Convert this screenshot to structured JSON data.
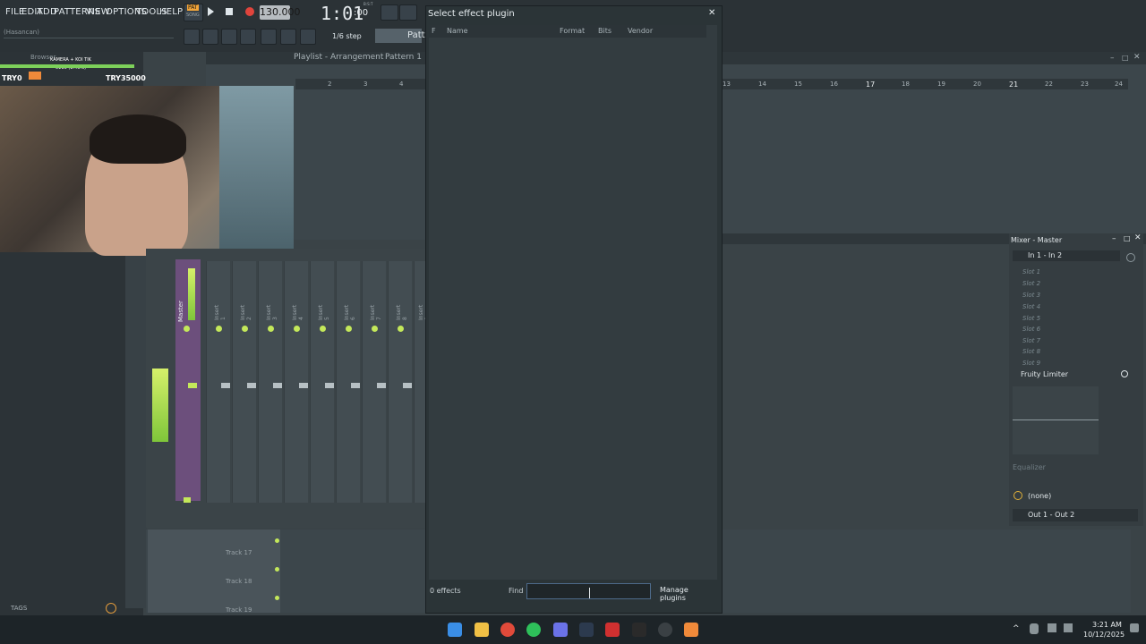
{
  "menu": [
    "FILE",
    "EDIT",
    "ADD",
    "PATTERNS",
    "VIEW",
    "OPTIONS",
    "TOOLS",
    "HELP"
  ],
  "transport": {
    "pat_label": "PAT",
    "song_label": "SONG",
    "tempo": "130.000",
    "time": "1:01",
    "time_small": ":00",
    "time_sub": "B:S:T"
  },
  "header": {
    "user_hint": "(Hasancan)",
    "snap": "1/6 step",
    "pattern_button": "Patte"
  },
  "playlist": {
    "title": "Playlist - Arrangement",
    "pattern": "Pattern 1"
  },
  "browser": {
    "label": "Browser",
    "tags_label": "TAGS"
  },
  "overlay": {
    "left_text": "TRY0",
    "right_text": "TRY35000",
    "cam_caption": "KAMERA + KOI TIK",
    "cam_sub": "5116 (1.46%)"
  },
  "ruler": {
    "left": [
      "2",
      "3",
      "4"
    ],
    "right": [
      "13",
      "14",
      "15",
      "16",
      "17",
      "18",
      "19",
      "20",
      "21",
      "22",
      "23",
      "24"
    ]
  },
  "mixer": {
    "master_label": "Master",
    "inserts": [
      "Insert 1",
      "Insert 2",
      "Insert 3",
      "Insert 4",
      "Insert 5",
      "Insert 6",
      "Insert 7",
      "Insert 8",
      "Insert 9"
    ],
    "top_nums": [
      "1",
      "2",
      "3",
      "4",
      "5",
      "6",
      "7",
      "8"
    ]
  },
  "mixer_master": {
    "title": "Mixer - Master",
    "input": "In 1 - In 2",
    "slots": [
      "Slot 1",
      "Slot 2",
      "Slot 3",
      "Slot 4",
      "Slot 5",
      "Slot 6",
      "Slot 7",
      "Slot 8",
      "Slot 9"
    ],
    "active_plugin": "Fruity Limiter",
    "equalizer": "Equalizer",
    "send": "(none)",
    "output": "Out 1 - Out 2"
  },
  "tracks": [
    "Track 17",
    "Track 18",
    "Track 19"
  ],
  "dialog": {
    "title": "Select effect plugin",
    "columns": {
      "f": "F",
      "name": "Name",
      "format": "Format",
      "bits": "Bits",
      "vendor": "Vendor"
    },
    "count": "0 effects",
    "find_label": "Find",
    "find_value": "",
    "manage_button": "Manage plugins"
  },
  "taskbar": {
    "time": "3:21 AM",
    "date": "10/12/2025"
  },
  "colors": {
    "accent_green": "#c4e85a",
    "dialog_bg": "#2b3437",
    "record_red": "#e0443c"
  }
}
